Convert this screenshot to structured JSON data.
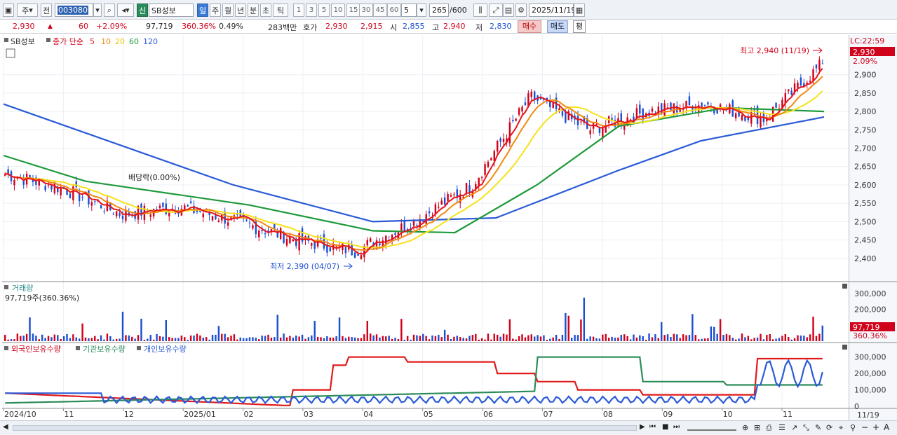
{
  "toolbar": {
    "period_primary": "주",
    "prev_label": "전",
    "code": "003080",
    "market_badge": "신",
    "stock_name": "SB성보",
    "periods": [
      "일",
      "주",
      "월",
      "년",
      "분",
      "초",
      "틱"
    ],
    "active_period": "일",
    "intervals": [
      "1",
      "3",
      "5",
      "10",
      "15",
      "30",
      "45",
      "60"
    ],
    "interval_value": "5",
    "count": "265",
    "count_max": "/600",
    "date": "2025/11/19"
  },
  "quote": {
    "price": "2,930",
    "change": "60",
    "change_pct": "+2.09%",
    "volume": "97,719",
    "volume_ratio": "360.36%",
    "turnover": "0.49%",
    "amount": "283백만",
    "ask_label": "호가",
    "ask": "2,930",
    "bid": "2,915",
    "open_label": "시",
    "open": "2,855",
    "high_label": "고",
    "high": "2,940",
    "low_label": "저",
    "low": "2,830",
    "buy_label": "매수",
    "sell_label": "매도",
    "eq_label": "평"
  },
  "price_panel": {
    "legend_name": "SB성보",
    "legend_ma_label": "종가 단순",
    "ma_periods": [
      "5",
      "10",
      "20",
      "60",
      "120"
    ],
    "high_annot": "최고 2,940 (11/19)",
    "low_annot": "최저 2,390 (04/07)",
    "dividend_annot": "배당락(0.00%)",
    "last_time": "LC:22:59",
    "last_price": "2,930",
    "last_pct": "2.09%"
  },
  "volume_panel": {
    "title": "거래량",
    "info": "97,719주(360.36%)",
    "last_volume": "97,719",
    "last_ratio": "360.36%"
  },
  "holding_panel": {
    "legend": [
      "외국인보유수량",
      "기관보유수량",
      "개인보유수량"
    ]
  },
  "x_axis": {
    "labels": [
      "2024/10",
      "11",
      "12",
      "2025/01",
      "02",
      "03",
      "04",
      "05",
      "06",
      "07",
      "08",
      "09",
      "10",
      "11"
    ],
    "right_label": "11/19"
  },
  "colors": {
    "up": "#d0021b",
    "down": "#1c4fd0",
    "ma5": "#e8141b",
    "ma10": "#f08a10",
    "ma20": "#f5e21a",
    "ma60": "#1e9a3a",
    "ma120": "#2a5bd7",
    "foreign": "#e11a1a",
    "institution": "#2a8c5a",
    "individual": "#2a5bd7"
  },
  "chart_data": [
    {
      "type": "candlestick",
      "title": "SB성보",
      "x_range": [
        "2024/10",
        "2025/11/19"
      ],
      "ylim": [
        2350,
        2970
      ],
      "yticks": [
        2400,
        2450,
        2500,
        2550,
        2600,
        2650,
        2700,
        2750,
        2800,
        2850,
        2900
      ],
      "anchors": {
        "high": {
          "date": "11/19",
          "value": 2940
        },
        "low": {
          "date": "04/07",
          "value": 2390
        },
        "last": 2930
      },
      "close_path": [
        [
          "2024/10",
          2630
        ],
        [
          "11",
          2590
        ],
        [
          "12",
          2520
        ],
        [
          "2025/01",
          2540
        ],
        [
          "02",
          2500
        ],
        [
          "03",
          2450
        ],
        [
          "04",
          2420
        ],
        [
          "05",
          2500
        ],
        [
          "06",
          2600
        ],
        [
          "07",
          2840
        ],
        [
          "08",
          2750
        ],
        [
          "09",
          2800
        ],
        [
          "10",
          2820
        ],
        [
          "11",
          2780
        ],
        [
          "11/19",
          2930
        ]
      ],
      "series": [
        {
          "name": "120",
          "values": [
            [
              0,
              2820
            ],
            [
              0.28,
              2600
            ],
            [
              0.45,
              2500
            ],
            [
              0.6,
              2510
            ],
            [
              0.75,
              2640
            ],
            [
              0.85,
              2720
            ],
            [
              1,
              2785
            ]
          ]
        },
        {
          "name": "60",
          "values": [
            [
              0,
              2680
            ],
            [
              0.1,
              2610
            ],
            [
              0.3,
              2545
            ],
            [
              0.45,
              2475
            ],
            [
              0.55,
              2470
            ],
            [
              0.65,
              2600
            ],
            [
              0.75,
              2760
            ],
            [
              0.88,
              2810
            ],
            [
              1,
              2800
            ]
          ]
        }
      ]
    },
    {
      "type": "bar",
      "title": "거래량",
      "yticks": [
        100000,
        200000,
        300000
      ],
      "last": 97719
    },
    {
      "type": "line",
      "series_names": [
        "외국인보유수량",
        "기관보유수량",
        "개인보유수량"
      ],
      "yticks": [
        0,
        100000,
        200000,
        300000
      ]
    }
  ]
}
